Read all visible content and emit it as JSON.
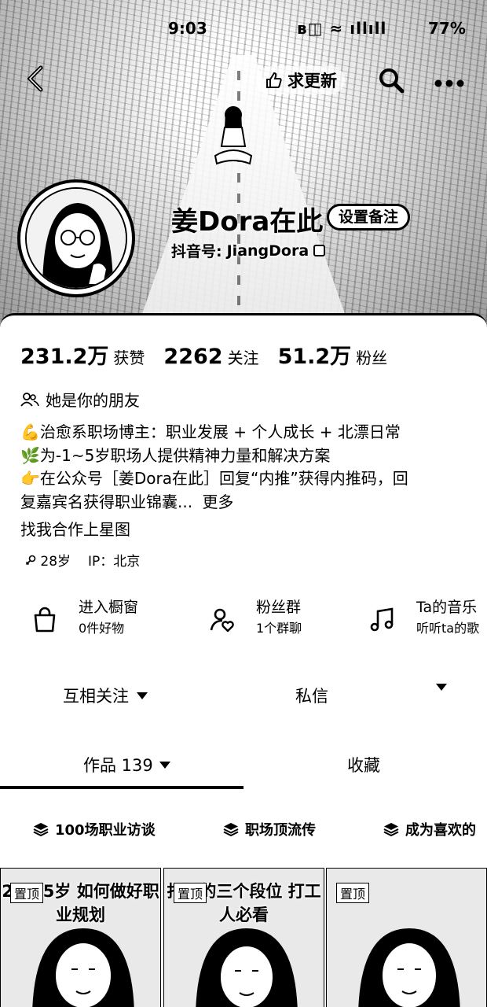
{
  "status_bar": {
    "time": "9:03",
    "signal_icons": "ʙ◫ ≈ ıllıll",
    "battery": "77%"
  },
  "top_bar": {
    "update_label": "求更新"
  },
  "profile": {
    "nickname": "姜Dora在此",
    "remark_button": "设置备注",
    "account_label": "抖音号:",
    "account_id": "JiangDora"
  },
  "stats": [
    {
      "value": "231.2万",
      "label": "获赞"
    },
    {
      "value": "2262",
      "label": "关注"
    },
    {
      "value": "51.2万",
      "label": "粉丝"
    }
  ],
  "friend_text": "她是你的朋友",
  "bio": {
    "line1": "💪治愈系职场博主：职业发展 + 个人成长 + 北漂日常",
    "line2": "🌿为-1~5岁职场人提供精神力量和解决方案",
    "line3": "👉在公众号［姜Dora在此］回复“内推”获得内推码，回",
    "line4": "复嘉宾名获得职业锦囊...",
    "more": "更多"
  },
  "collab_text": "找我合作上星图",
  "meta": {
    "age": "28岁",
    "ip": "IP：北京"
  },
  "entries": [
    {
      "title": "进入橱窗",
      "sub": "0件好物",
      "icon": "shopping-bag-icon"
    },
    {
      "title": "粉丝群",
      "sub": "1个群聊",
      "icon": "fan-group-icon"
    },
    {
      "title": "Ta的音乐",
      "sub": "听听ta的歌",
      "icon": "music-note-icon"
    }
  ],
  "actions": {
    "follow": "互相关注",
    "message": "私信"
  },
  "tabs": {
    "works": "作品 139",
    "favorites": "收藏"
  },
  "collections": [
    "100场职业访谈",
    "职场顶流传",
    "成为喜欢的"
  ],
  "videos": [
    {
      "pin": "置顶",
      "caption": "25-35岁 如何做好职业规划"
    },
    {
      "pin": "置顶",
      "caption": "打工的三个段位 打工人必看"
    },
    {
      "pin": "置顶",
      "caption": ""
    }
  ]
}
